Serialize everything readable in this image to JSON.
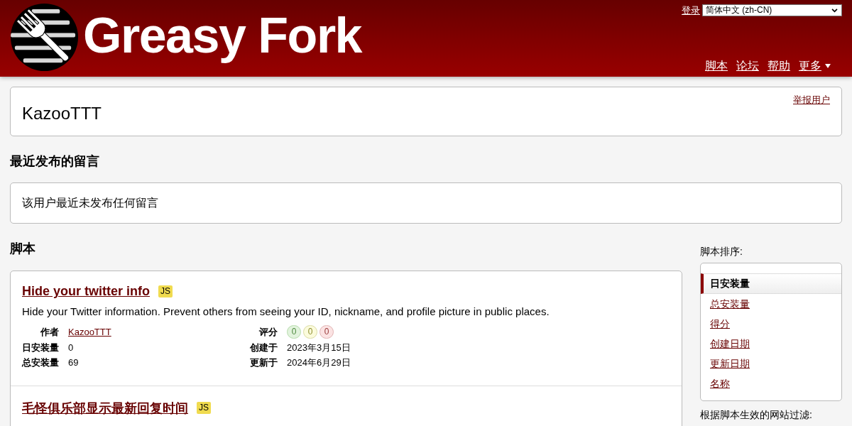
{
  "header": {
    "site_name": "Greasy Fork",
    "login": "登录",
    "language": "简体中文 (zh-CN)",
    "nav": [
      {
        "label": "脚本",
        "dropdown": false
      },
      {
        "label": "论坛",
        "dropdown": false
      },
      {
        "label": "帮助",
        "dropdown": false
      },
      {
        "label": "更多",
        "dropdown": true
      }
    ]
  },
  "user": {
    "name": "KazooTTT",
    "report": "举报用户"
  },
  "comments": {
    "heading": "最近发布的留言",
    "empty_text": "该用户最近未发布任何留言"
  },
  "scripts": {
    "heading": "脚本",
    "items": [
      {
        "title": "Hide your twitter info",
        "type": "JS",
        "description": "Hide your Twitter information. Prevent others from seeing your ID, nickname, and profile picture in public places.",
        "stats_left": [
          {
            "label": "作者",
            "kind": "link",
            "value": "KazooTTT"
          },
          {
            "label": "日安装量",
            "kind": "text",
            "value": "0"
          },
          {
            "label": "总安装量",
            "kind": "text",
            "value": "69"
          }
        ],
        "stats_right": [
          {
            "label": "评分",
            "kind": "ratings",
            "ratings": [
              {
                "kind": "good",
                "value": "0"
              },
              {
                "kind": "ok",
                "value": "0"
              },
              {
                "kind": "bad",
                "value": "0"
              }
            ]
          },
          {
            "label": "创建于",
            "kind": "text",
            "value": "2023年3月15日"
          },
          {
            "label": "更新于",
            "kind": "text",
            "value": "2024年6月29日"
          }
        ]
      },
      {
        "title": "毛怪俱乐部显示最新回复时间",
        "type": "JS"
      }
    ]
  },
  "sidebar": {
    "sort_label": "脚本排序:",
    "sort_options": [
      {
        "label": "日安装量",
        "selected": true
      },
      {
        "label": "总安装量",
        "selected": false
      },
      {
        "label": "得分",
        "selected": false
      },
      {
        "label": "创建日期",
        "selected": false
      },
      {
        "label": "更新日期",
        "selected": false
      },
      {
        "label": "名称",
        "selected": false
      }
    ],
    "filter_label": "根据脚本生效的网站过滤:"
  }
}
